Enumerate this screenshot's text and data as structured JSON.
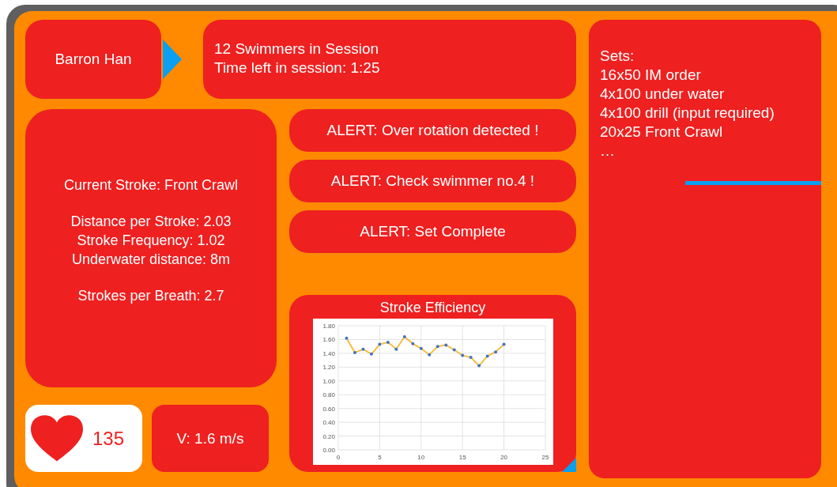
{
  "athlete": {
    "name": "Barron Han"
  },
  "session": {
    "lines": [
      "12 Swimmers in Session",
      "Time left in session: 1:25"
    ]
  },
  "stroke_stats": {
    "groups": [
      [
        "Current Stroke: Front Crawl"
      ],
      [
        "Distance per Stroke: 2.03",
        "Stroke Frequency: 1.02",
        "Underwater distance: 8m"
      ],
      [
        "Strokes per Breath: 2.7"
      ]
    ]
  },
  "alerts": [
    "ALERT: Over rotation detected !",
    "ALERT: Check swimmer no.4 !",
    "ALERT: Set Complete"
  ],
  "chart_panel": {
    "chart_data": {
      "type": "line",
      "title": "Stroke Efficiency",
      "grid": true,
      "x": [
        1,
        2,
        3,
        4,
        5,
        6,
        7,
        8,
        9,
        10,
        11,
        12,
        13,
        14,
        15,
        16,
        17,
        18,
        19,
        20
      ],
      "series": [
        {
          "color": "#f5b82e",
          "values": [
            1.62,
            1.41,
            1.46,
            1.39,
            1.53,
            1.56,
            1.46,
            1.64,
            1.54,
            1.47,
            1.38,
            1.5,
            1.52,
            1.45,
            1.37,
            1.34,
            1.22,
            1.36,
            1.42,
            1.53
          ]
        }
      ],
      "xlim": [
        0,
        25
      ],
      "ylim": [
        0,
        1.8
      ],
      "xticks": [
        0,
        5,
        10,
        15,
        20,
        25
      ],
      "yticks": [
        {
          "value": 0,
          "label": "0.00"
        },
        {
          "value": 0.2,
          "label": "0.20"
        },
        {
          "value": 0.4,
          "label": "0.40"
        },
        {
          "value": 0.6,
          "label": "0.60"
        },
        {
          "value": 0.8,
          "label": "0.80"
        },
        {
          "value": 1.0,
          "label": "1.00"
        },
        {
          "value": 1.2,
          "label": "1.20"
        },
        {
          "value": 1.4,
          "label": "1.40"
        },
        {
          "value": 1.6,
          "label": "1.60"
        },
        {
          "value": 1.8,
          "label": "1.80"
        }
      ]
    }
  },
  "heart_rate": {
    "value": "135"
  },
  "velocity": {
    "value": "V: 1.6 m/s"
  },
  "sets": {
    "title": "Sets:",
    "items": [
      "16x50 IM order",
      "4x100 under water",
      "4x100 drill (input required)",
      "20x25 Front Crawl",
      "…"
    ]
  }
}
